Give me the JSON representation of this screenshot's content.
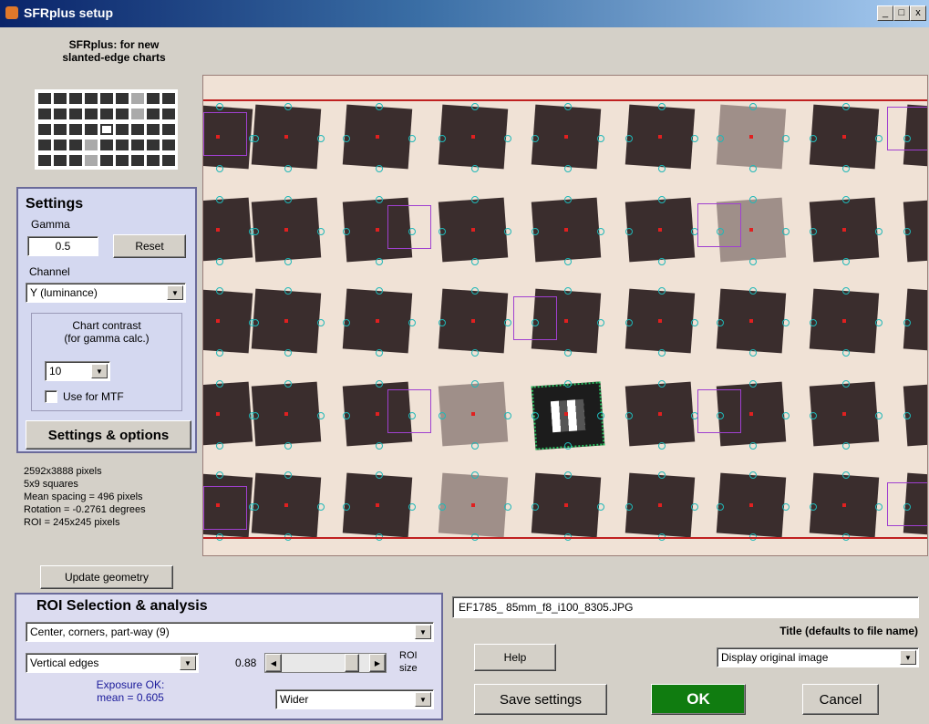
{
  "window": {
    "title": "SFRplus setup",
    "buttons": [
      "_",
      "□",
      "x"
    ]
  },
  "header": {
    "line1": "SFRplus:  for new",
    "line2": "slanted-edge charts"
  },
  "settings": {
    "title": "Settings",
    "gamma_label": "Gamma",
    "gamma_value": "0.5",
    "reset_label": "Reset",
    "channel_label": "Channel",
    "channel_value": "Y (luminance)",
    "contrast_line1": "Chart contrast",
    "contrast_line2": "(for gamma calc.)",
    "contrast_value": "10",
    "use_for_mtf_label": "Use for MTF",
    "use_for_mtf_checked": false,
    "options_label": "Settings & options"
  },
  "info": {
    "pixels": "2592x3888 pixels",
    "squares": "5x9 squares",
    "spacing": "Mean spacing = 496 pixels",
    "rotation": "Rotation = -0.2761 degrees",
    "roi": "ROI = 245x245 pixels"
  },
  "update_geometry_label": "Update geometry",
  "roi": {
    "title": "ROI Selection & analysis",
    "region_value": "Center, corners, part-way  (9)",
    "edges_value": "Vertical edges",
    "size_value": "0.88",
    "size_fraction": 0.82,
    "size_label_line1": "ROI",
    "size_label_line2": "size",
    "exposure_line1": "Exposure OK:",
    "exposure_line2": "mean = 0.605",
    "width_value": "Wider"
  },
  "file": {
    "name": "EF1785_ 85mm_f8_i100_8305.JPG",
    "title_label": "Title (defaults to file name)"
  },
  "buttons": {
    "help": "Help",
    "save": "Save settings",
    "ok": "OK",
    "cancel": "Cancel"
  },
  "display_value": "Display original image",
  "colors": {
    "ok_green": "#107c10",
    "panel_blue": "#dcdcf0",
    "chart_bg": "#f0e2d6",
    "square_dark": "#3a2d2d",
    "marker_cyan": "#1fb8b8",
    "roi_purple": "#a040d0"
  }
}
